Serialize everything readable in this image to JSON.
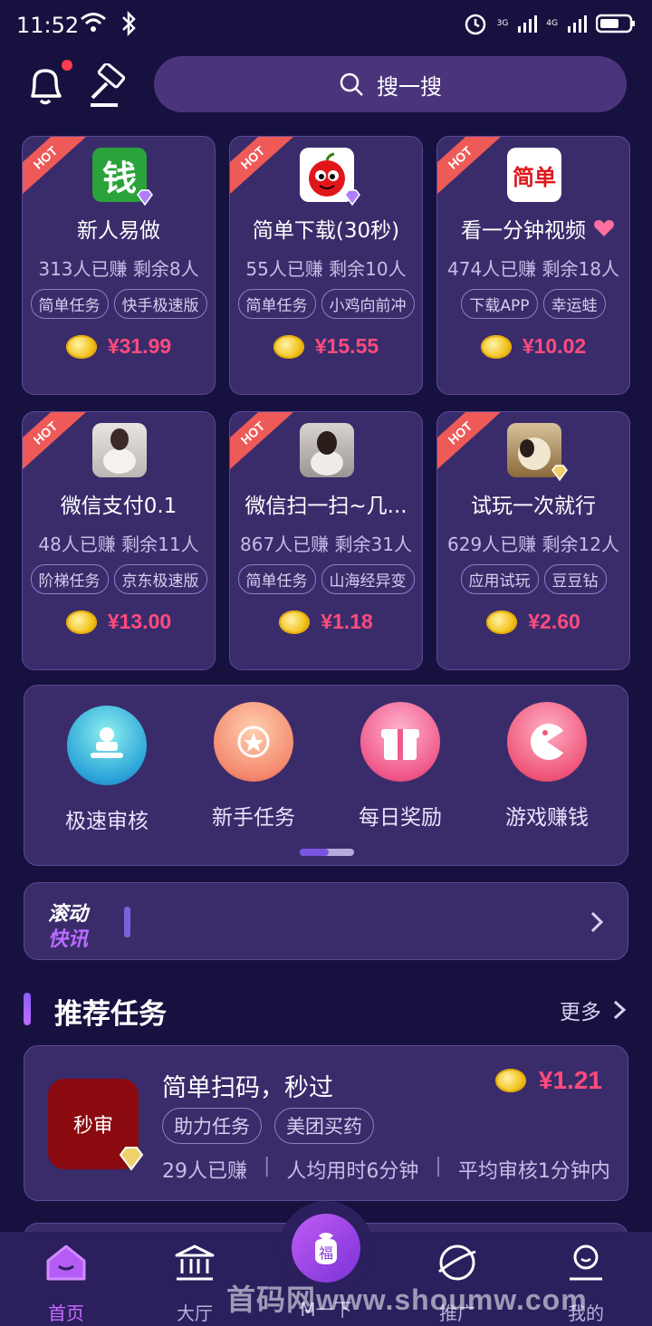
{
  "status_bar": {
    "time": "11:52",
    "net_3g": "3G",
    "net_4g": "4G"
  },
  "search": {
    "placeholder": "搜一搜"
  },
  "task_cards": [
    {
      "title": "新人易做",
      "meta": "313人已赚  剩余8人",
      "tags": [
        "简单任务",
        "快手极速版"
      ],
      "price": "¥31.99",
      "hot": "HOT",
      "icon": "qian-app-icon",
      "icon_text": "钱"
    },
    {
      "title": "简单下载(30秒)",
      "meta": "55人已赚  剩余10人",
      "tags": [
        "简单任务",
        "小鸡向前冲"
      ],
      "price": "¥15.55",
      "hot": "HOT",
      "icon": "apple-cartoon-icon"
    },
    {
      "title": "看一分钟视频",
      "meta": "474人已赚  剩余18人",
      "tags": [
        "下载APP",
        "幸运蛙"
      ],
      "price": "¥10.02",
      "hot": "HOT",
      "icon": "jiandan-app-icon",
      "icon_text": "简单"
    },
    {
      "title": "微信支付0.1",
      "meta": "48人已赚  剩余11人",
      "tags": [
        "阶梯任务",
        "京东极速版"
      ],
      "price": "¥13.00",
      "hot": "HOT",
      "icon": "user-avatar-icon"
    },
    {
      "title": "微信扫一扫~几...",
      "meta": "867人已赚  剩余31人",
      "tags": [
        "简单任务",
        "山海经异变"
      ],
      "price": "¥1.18",
      "hot": "HOT",
      "icon": "user-avatar-icon"
    },
    {
      "title": "试玩一次就行",
      "meta": "629人已赚  剩余12人",
      "tags": [
        "应用试玩",
        "豆豆钻"
      ],
      "price": "¥2.60",
      "hot": "HOT",
      "icon": "user-avatar-icon"
    }
  ],
  "quick_entries": [
    {
      "label": "极速审核",
      "icon": "stamp-icon",
      "color_from": "#5ee2e8",
      "color_to": "#2d7bd8"
    },
    {
      "label": "新手任务",
      "icon": "sparkle-ball-icon",
      "color_from": "#ffb28a",
      "color_to": "#f0605e"
    },
    {
      "label": "每日奖励",
      "icon": "gift-icon",
      "color_from": "#ff8ab0",
      "color_to": "#e83a6c"
    },
    {
      "label": "游戏赚钱",
      "icon": "pacman-icon",
      "color_from": "#ff8aa8",
      "color_to": "#e8395e"
    }
  ],
  "news": {
    "line1": "滚动",
    "line2": "快讯"
  },
  "section": {
    "title": "推荐任务",
    "more": "更多"
  },
  "recommended": {
    "title": "简单扫码，秒过",
    "icon_text": "秒审",
    "price": "¥1.21",
    "tags": [
      "助力任务",
      "美团买药"
    ],
    "meta": [
      "29人已赚",
      "人均用时6分钟",
      "平均审核1分钟内"
    ],
    "meta_sep": "|"
  },
  "bottom_nav": [
    {
      "label": "首页",
      "icon": "home-icon",
      "active": true
    },
    {
      "label": "大厅",
      "icon": "bank-icon",
      "active": false
    },
    {
      "label": "M一下",
      "icon": "fu-bag-icon",
      "active": false
    },
    {
      "label": "推广",
      "icon": "planet-icon",
      "active": false
    },
    {
      "label": "我的",
      "icon": "profile-icon",
      "active": false
    }
  ],
  "center_fab": {
    "glyph": "福"
  },
  "watermark": "首码网www.shoumw.com",
  "colors": {
    "background": "#17113f",
    "card": "#3a2c6b",
    "price": "#ff4b7d",
    "accent": "#c96dff"
  }
}
